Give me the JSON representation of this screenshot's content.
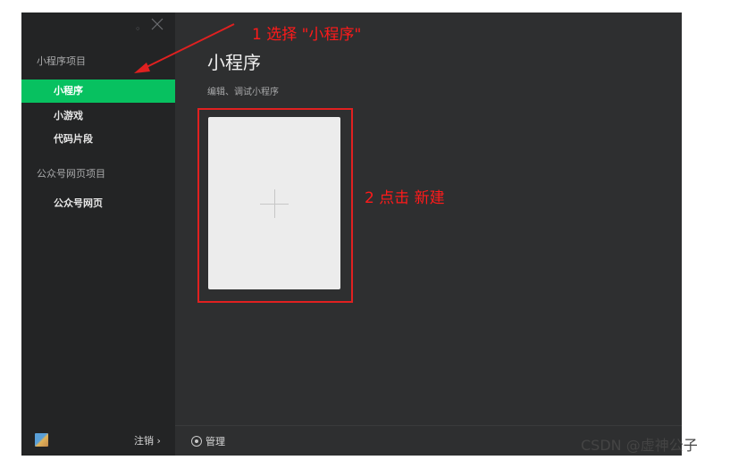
{
  "window_controls": {
    "minimize_glyph": "◦",
    "close_glyph": "╳"
  },
  "sidebar": {
    "sections": [
      {
        "label": "小程序项目",
        "items": [
          {
            "label": "小程序",
            "active": true
          },
          {
            "label": "小游戏"
          },
          {
            "label": "代码片段"
          }
        ]
      },
      {
        "label": "公众号网页项目",
        "items": [
          {
            "label": "公众号网页"
          }
        ]
      }
    ],
    "footer": {
      "logout_label": "注销 ›"
    }
  },
  "main": {
    "title": "小程序",
    "subtitle": "编辑、调试小程序",
    "footer": {
      "manage_label": "管理"
    }
  },
  "annotations": {
    "step1": "1 选择 \"小程序\"",
    "step2": "2 点击 新建",
    "color": "#ff1a1a"
  },
  "watermark": "CSDN @虚神公子",
  "colors": {
    "accent": "#07c160",
    "background": "#2e2f30",
    "sidebar": "#232425"
  }
}
